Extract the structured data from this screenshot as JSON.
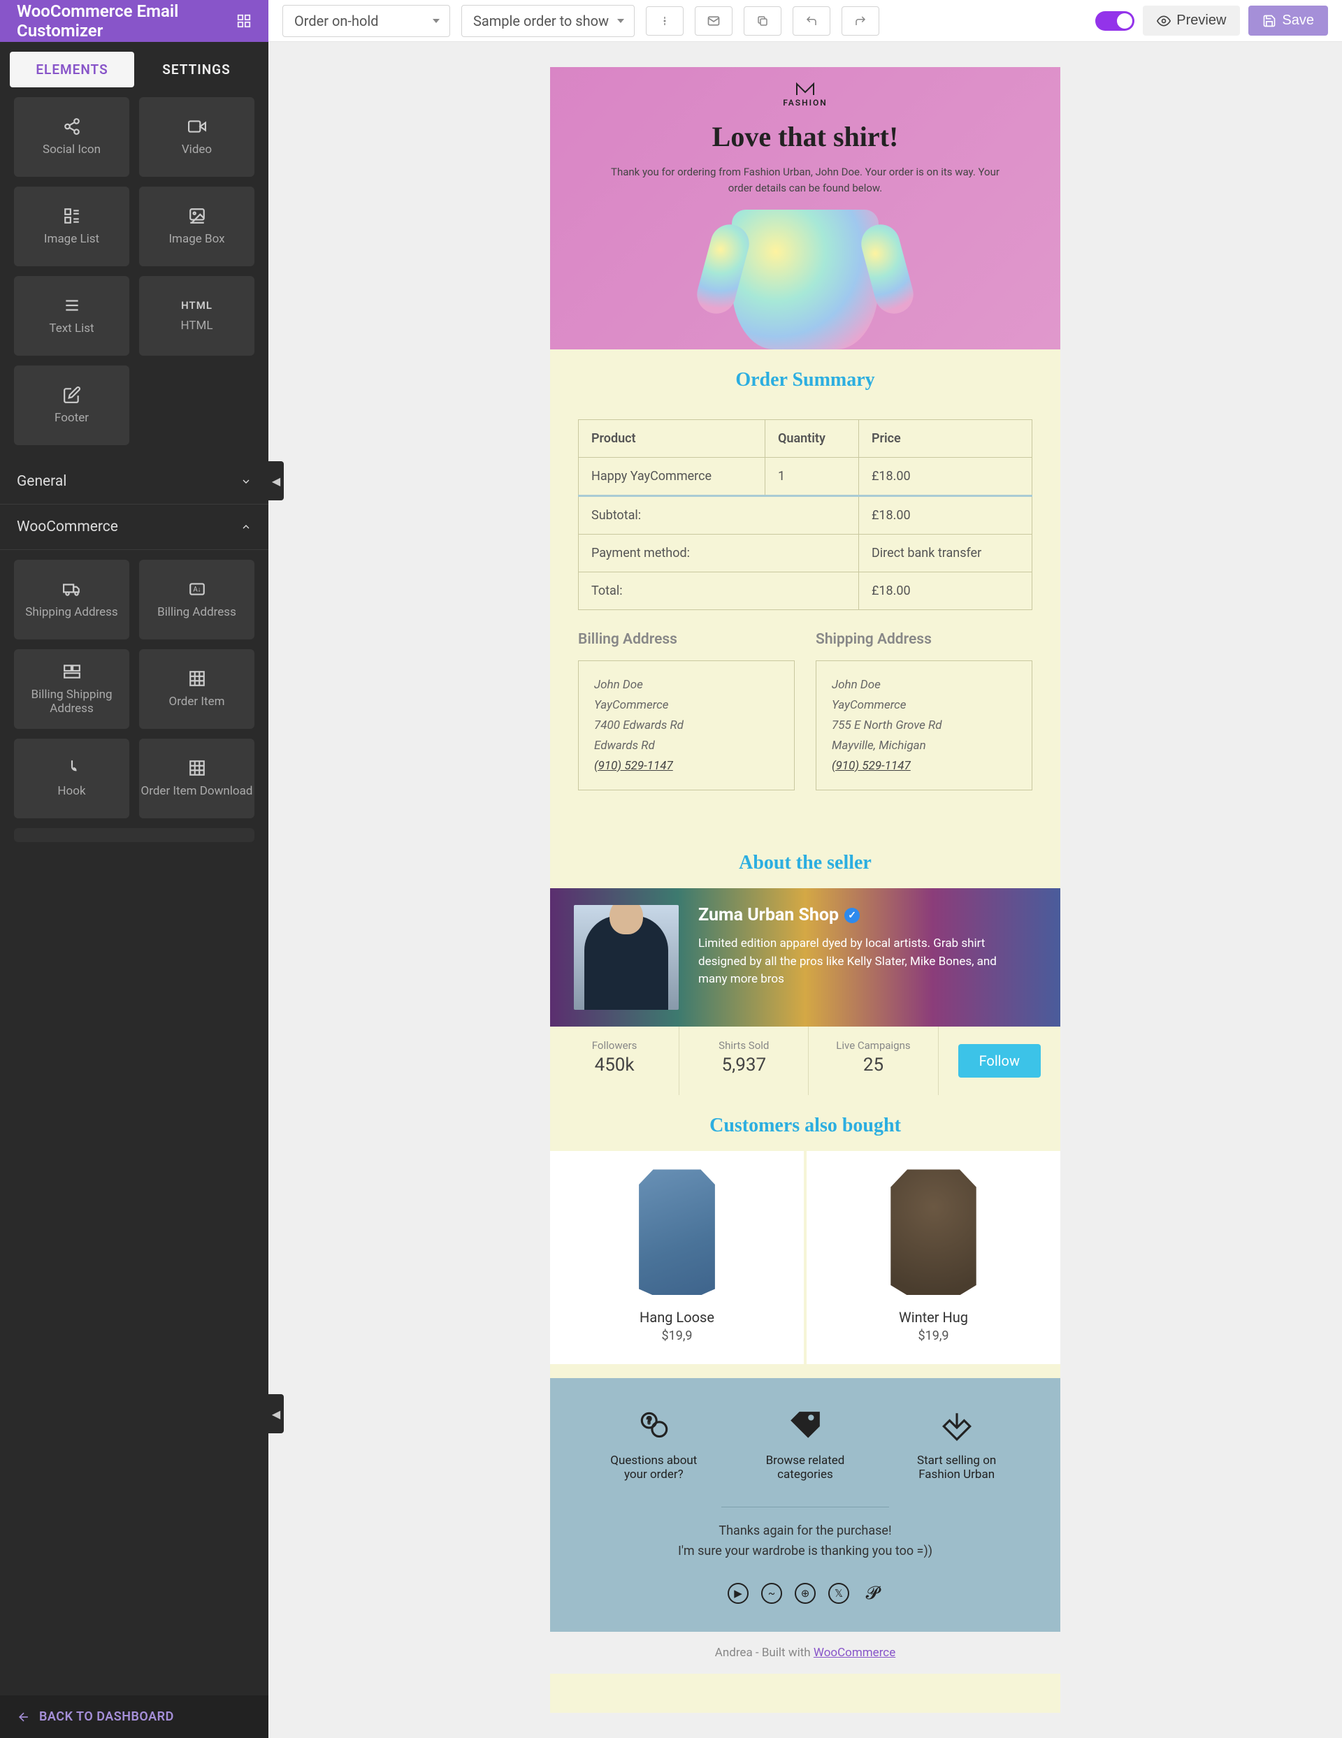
{
  "app_title": "WooCommerce Email Customizer",
  "topbar": {
    "order_status": "Order on-hold",
    "sample_order": "Sample order to show",
    "preview": "Preview",
    "save": "Save"
  },
  "sidebar": {
    "tabs": {
      "elements": "ELEMENTS",
      "settings": "SETTINGS"
    },
    "elements_top": [
      {
        "label": "Social Icon"
      },
      {
        "label": "Video"
      },
      {
        "label": "Image List"
      },
      {
        "label": "Image Box"
      },
      {
        "label": "Text List"
      },
      {
        "label": "HTML"
      },
      {
        "label": "Footer"
      }
    ],
    "sections": {
      "general": "General",
      "woocommerce": "WooCommerce"
    },
    "woo_elements": [
      {
        "label": "Shipping Address"
      },
      {
        "label": "Billing Address"
      },
      {
        "label": "Billing Shipping Address"
      },
      {
        "label": "Order Item"
      },
      {
        "label": "Hook"
      },
      {
        "label": "Order Item Download"
      }
    ],
    "back": "BACK TO DASHBOARD"
  },
  "email": {
    "logo_text": "FASHION",
    "title": "Love that shirt!",
    "intro": "Thank you for ordering from Fashion Urban, John Doe. Your order is on its way. Your order details can be found below.",
    "summary_title": "Order Summary",
    "table": {
      "headers": {
        "product": "Product",
        "quantity": "Quantity",
        "price": "Price"
      },
      "item": {
        "name": "Happy YayCommerce",
        "qty": "1",
        "price": "£18.00"
      },
      "subtotal_label": "Subtotal:",
      "subtotal": "£18.00",
      "payment_label": "Payment method:",
      "payment": "Direct bank transfer",
      "total_label": "Total:",
      "total": "£18.00"
    },
    "billing_title": "Billing Address",
    "shipping_title": "Shipping Address",
    "billing": {
      "name": "John Doe",
      "company": "YayCommerce",
      "line1": "7400 Edwards Rd",
      "line2": "Edwards Rd",
      "phone": "(910) 529-1147"
    },
    "shipping": {
      "name": "John Doe",
      "company": "YayCommerce",
      "line1": "755 E North Grove Rd",
      "line2": "Mayville, Michigan",
      "phone": "(910) 529-1147"
    },
    "about_title": "About the seller",
    "seller": {
      "name": "Zuma Urban Shop",
      "desc": "Limited edition apparel dyed by local artists. Grab shirt designed by all the pros like Kelly Slater, Mike Bones, and many more bros",
      "stats": {
        "followers_label": "Followers",
        "followers": "450k",
        "sold_label": "Shirts Sold",
        "sold": "5,937",
        "campaigns_label": "Live Campaigns",
        "campaigns": "25"
      },
      "follow": "Follow"
    },
    "also_title": "Customers also bought",
    "products": [
      {
        "name": "Hang Loose",
        "price": "$19,9"
      },
      {
        "name": "Winter Hug",
        "price": "$19,9"
      }
    ],
    "footer": {
      "links": [
        {
          "text": "Questions about your order?"
        },
        {
          "text": "Browse related categories"
        },
        {
          "text": "Start selling on Fashion Urban"
        }
      ],
      "msg1": "Thanks again for the purchase!",
      "msg2": "I'm sure your wardrobe is thanking you too =))",
      "built_pre": "Andrea - Built with ",
      "built_link": "WooCommerce"
    }
  }
}
